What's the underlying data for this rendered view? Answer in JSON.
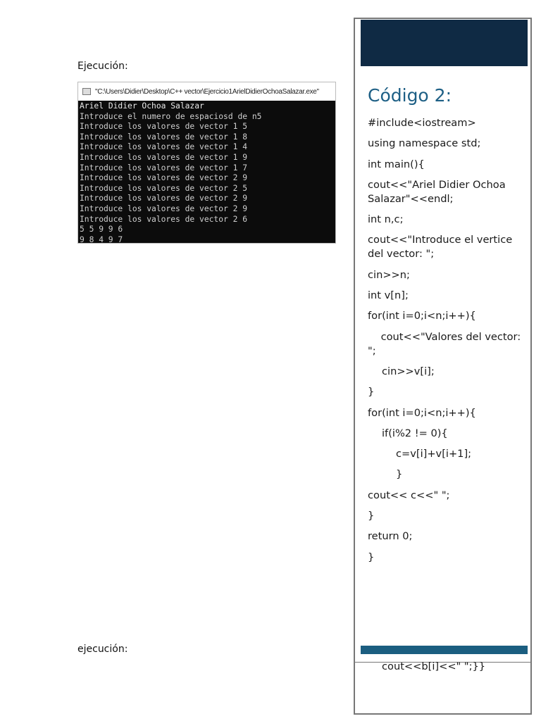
{
  "left": {
    "execution_label": "Ejecución:",
    "execution_label2": "ejecución:",
    "terminal": {
      "title": "\"C:\\Users\\Didier\\Desktop\\C++ vector\\Ejercicio1ArielDidierOchoaSalazar.exe\"",
      "lines": [
        "Ariel Didier Ochoa Salazar",
        "Introduce el numero de espaciosd de n5",
        "Introduce los valores de vector 1 5",
        "Introduce los valores de vector 1 8",
        "Introduce los valores de vector 1 4",
        "Introduce los valores de vector 1 9",
        "Introduce los valores de vector 1 7",
        "Introduce los valores de vector 2 9",
        "Introduce los valores de vector 2 5",
        "Introduce los valores de vector 2 9",
        "Introduce los valores de vector 2 9",
        "Introduce los valores de vector 2 6",
        "5 5 9 9 6",
        "9 8 4 9 7"
      ]
    }
  },
  "sidebar": {
    "title": "Código 2:",
    "code": [
      {
        "text": "#include<iostream>",
        "indent": 0
      },
      {
        "text": "using namespace std;",
        "indent": 0
      },
      {
        "text": "int main(){",
        "indent": 0
      },
      {
        "text": "cout<<\"Ariel Didier Ochoa Salazar\"<<endl;",
        "indent": 0
      },
      {
        "text": "int n,c;",
        "indent": 0
      },
      {
        "text": "cout<<\"Introduce el vertice del vector: \";",
        "indent": 0
      },
      {
        "text": "cin>>n;",
        "indent": 0
      },
      {
        "text": "int v[n];",
        "indent": 0
      },
      {
        "text": "for(int i=0;i<n;i++){",
        "indent": 0
      },
      {
        "text": "    cout<<\"Valores del vector: \";",
        "indent": 0
      },
      {
        "text": "cin>>v[i];",
        "indent": 1
      },
      {
        "text": "}",
        "indent": 0
      },
      {
        "text": "for(int i=0;i<n;i++){",
        "indent": 0
      },
      {
        "text": "if(i%2 != 0){",
        "indent": 1
      },
      {
        "text": "c=v[i]+v[i+1];",
        "indent": 2
      },
      {
        "text": "}",
        "indent": 2
      },
      {
        "text": "cout<< c<<\" \";",
        "indent": 0
      },
      {
        "text": "}",
        "indent": 0
      },
      {
        "text": "return 0;",
        "indent": 0
      },
      {
        "text": "}",
        "indent": 0
      }
    ],
    "continuation": "cout<<b[i]<<\" \";}}"
  }
}
